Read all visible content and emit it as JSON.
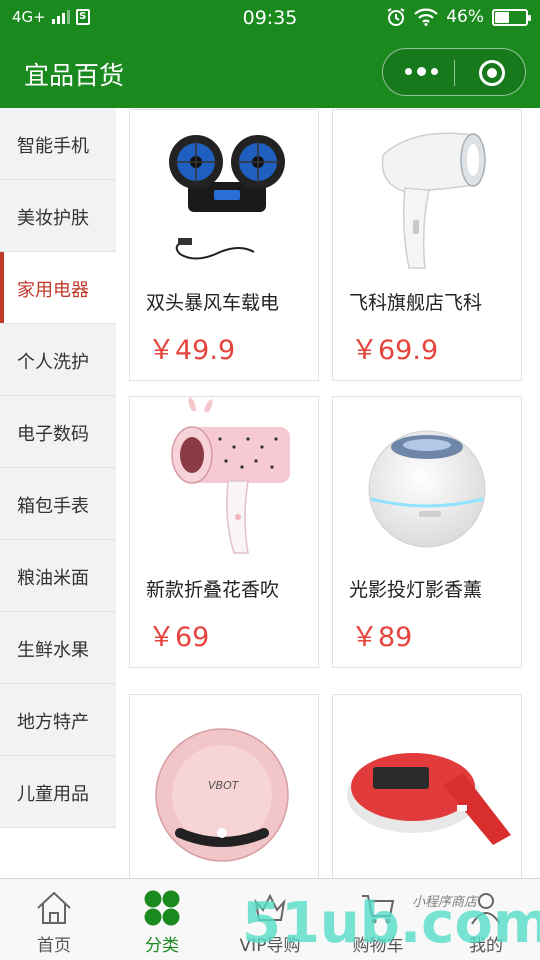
{
  "status_bar": {
    "network": "4G+",
    "sim_label": "S",
    "time": "09:35",
    "battery_percent": "46%",
    "battery_level": 0.46
  },
  "nav": {
    "title": "宜品百货"
  },
  "sidebar": {
    "items": [
      {
        "label": "智能手机"
      },
      {
        "label": "美妆护肤"
      },
      {
        "label": "家用电器"
      },
      {
        "label": "个人洗护"
      },
      {
        "label": "电子数码"
      },
      {
        "label": "箱包手表"
      },
      {
        "label": "粮油米面"
      },
      {
        "label": "生鲜水果"
      },
      {
        "label": "地方特产"
      },
      {
        "label": "儿童用品"
      }
    ],
    "active_index": 2
  },
  "products": [
    {
      "name": "双头暴风车载电",
      "price": "￥49.9",
      "image": "dual-car-fan"
    },
    {
      "name": "飞科旗舰店飞科",
      "price": "￥69.9",
      "image": "white-hair-dryer"
    },
    {
      "name": "新款折叠花香吹",
      "price": "￥69",
      "image": "pink-hair-dryer"
    },
    {
      "name": "光影投灯影香薰",
      "price": "￥89",
      "image": "aroma-diffuser"
    },
    {
      "name": "",
      "price": "",
      "image": "robot-vacuum",
      "brand_text": "VBOT"
    },
    {
      "name": "",
      "price": "",
      "image": "red-device"
    }
  ],
  "tab_bar": {
    "tabs": [
      {
        "label": "首页",
        "icon": "home-icon"
      },
      {
        "label": "分类",
        "icon": "category-icon"
      },
      {
        "label": "VIP导购",
        "icon": "vip-icon"
      },
      {
        "label": "购物车",
        "icon": "cart-icon"
      },
      {
        "label": "我的",
        "icon": "profile-icon"
      }
    ],
    "active_index": 1
  },
  "watermark": {
    "main_text": "51ub.com",
    "sub_text": "小程序商店"
  },
  "colors": {
    "brand_green": "#1a8a1f",
    "price_red": "#e5453c",
    "active_category": "#c0392b"
  }
}
